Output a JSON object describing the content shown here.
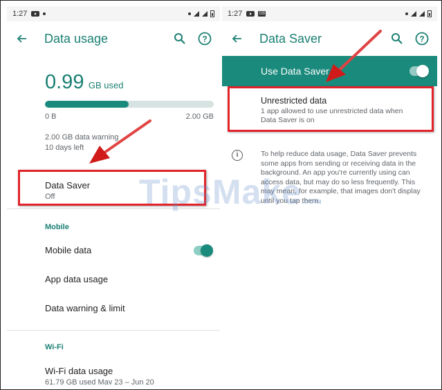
{
  "left": {
    "status": {
      "time": "1:27"
    },
    "title": "Data usage",
    "usage": {
      "amount": "0.99",
      "unit": "GB used",
      "min_label": "0 B",
      "max_label": "2.00 GB",
      "fill_fraction": 0.495
    },
    "warning": {
      "line1": "2.00 GB data warning",
      "line2": "10 days left"
    },
    "data_saver": {
      "title": "Data Saver",
      "subtitle": "Off"
    },
    "mobile": {
      "section": "Mobile",
      "mobile_data": "Mobile data",
      "app_data_usage": "App data usage",
      "warning_limit": "Data warning & limit"
    },
    "wifi": {
      "section": "Wi-Fi",
      "title": "Wi-Fi data usage",
      "subtitle": "61.79 GB used May 23 – Jun 20"
    }
  },
  "right": {
    "status": {
      "time": "1:27"
    },
    "title": "Data Saver",
    "use_label": "Use Data Saver",
    "unrestricted": {
      "title": "Unrestricted data",
      "subtitle": "1 app allowed to use unrestricted data when Data Saver is on"
    },
    "info": "To help reduce data usage, Data Saver prevents some apps from sending or receiving data in the background. An app you're currently using can access data, but may do so less frequently. This may mean, for example, that images don't display until you tap them."
  },
  "watermark": {
    "brand": "TipsMake",
    "suffix": ".com"
  },
  "colors": {
    "accent": "#1a7f72",
    "highlight": "#e2232a"
  }
}
